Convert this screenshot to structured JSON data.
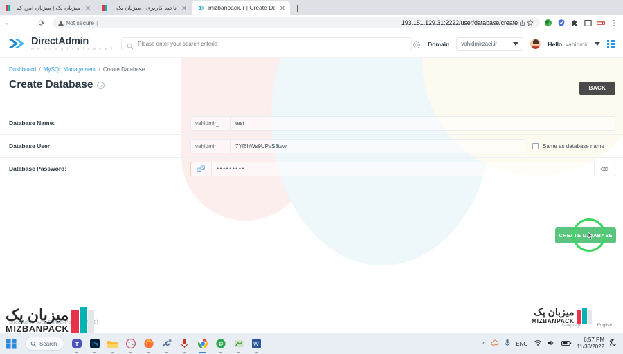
{
  "browser": {
    "tabs": [
      {
        "title": "میزبان یک | میزبان امن کسب و کار",
        "rtl": true,
        "active": false,
        "favicon": "mizbanpack-books-icon"
      },
      {
        "title": "ناحیه کاربری - میزبان یک | mizbanpack",
        "rtl": true,
        "active": false,
        "favicon": "mizbanpack-books-icon"
      },
      {
        "title": "mizbanpack.ir | Create Database",
        "rtl": false,
        "active": true,
        "favicon": "directadmin-icon"
      }
    ],
    "new_tab_label": "+",
    "nav": {
      "back": "←",
      "forward": "→",
      "reload": "⟳"
    },
    "security_label": "Not secure",
    "url": "193.151.129.31:2222/user/database/create",
    "omni_icons": [
      "share-icon",
      "bookmark-star-icon",
      "extension-globe-icon",
      "shield-icon",
      "extensions-puzzle-icon",
      "sidebar-icon",
      "profile-icon",
      "kebab-menu-icon"
    ]
  },
  "header": {
    "logo_name": "DirectAdmin",
    "logo_sub": "w e b   c o n t r o l   p a n e l",
    "search_placeholder": "Please enter your search criteria",
    "domain_label": "Domain",
    "domain_value": "vahidmirzaei.ir",
    "greeting_prefix": "Hello,",
    "greeting_user": "vahidmir"
  },
  "breadcrumb": {
    "items": [
      "Dashboard",
      "MySQL Management",
      "Create Database"
    ],
    "separator": "/"
  },
  "page": {
    "title": "Create Database",
    "help_glyph": "?",
    "back_label": "BACK"
  },
  "form": {
    "rows": [
      {
        "label": "Database Name:",
        "prefix": "vahidmir_",
        "value": "test",
        "type": "text"
      },
      {
        "label": "Database User:",
        "prefix": "vahidmir_",
        "value": "7Yf6hWs9UPvS8tvw",
        "type": "text",
        "checkbox_label": "Same as database name",
        "checkbox_checked": false
      },
      {
        "label": "Database Password:",
        "prefix_icon": "random-generate-icon",
        "value": "•••••••••",
        "type": "password",
        "eye_icon": "eye-icon"
      }
    ],
    "submit_label": "CREATE DATABASE"
  },
  "footer": {
    "copyright": "DirectAdmin Web Control Panel, 2022 (8)",
    "language_label": "Language",
    "language_value": "English"
  },
  "watermark": {
    "fa": "میزبان پک",
    "en": "MIZBANPACK"
  },
  "taskbar": {
    "search_placeholder": "Search",
    "apps": [
      "start-icon",
      "teams-icon",
      "photoshop-icon",
      "folder-icon",
      "paint-icon",
      "firefox-icon",
      "tool-icon",
      "mic-icon",
      "chrome-icon",
      "globe-browser-icon",
      "editor-icon",
      "word-icon"
    ],
    "language": "ENG",
    "time": "6:57 PM",
    "date": "11/30/2022",
    "tray_icons": [
      "chevron-up-icon",
      "onedrive-icon",
      "mic-tray-icon",
      "wifi-icon",
      "volume-icon",
      "battery-icon",
      "moon-icon"
    ]
  },
  "colors": {
    "accent_blue": "#2196f3",
    "green_button": "#5bc47f",
    "ripple_green": "#3bd65f",
    "back_button": "#4a4a4a",
    "link": "#3ba3d6"
  }
}
